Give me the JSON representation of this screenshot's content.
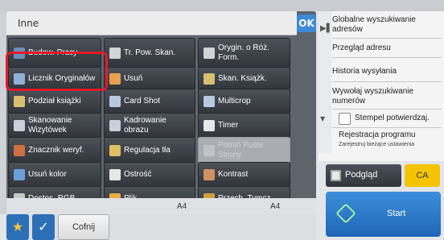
{
  "panel": {
    "title": "Inne",
    "ok_label": "OK"
  },
  "buttons": [
    {
      "id": "budow-pracy",
      "label": "Budow. Pracy",
      "icon_color": "#6b8fb8",
      "icon": "stack-icon"
    },
    {
      "id": "tr-pow-skan",
      "label": "Tr. Pow. Skan.",
      "icon_color": "#d4d4d4",
      "icon": "page-icon"
    },
    {
      "id": "orygin-roz-form",
      "label": "Orygin. o Róż. Form.",
      "icon_color": "#d4d4d4",
      "icon": "pages-icon"
    },
    {
      "id": "licznik-oryginalow",
      "label": "Licznik Oryginałów",
      "icon_color": "#8fb0d8",
      "icon": "counter-icon"
    },
    {
      "id": "usun",
      "label": "Usuń",
      "icon_color": "#e8a050",
      "icon": "erase-icon"
    },
    {
      "id": "skan-ksiazk",
      "label": "Skan. Książk.",
      "icon_color": "#d8c070",
      "icon": "book-icon"
    },
    {
      "id": "podzial-ksiazki",
      "label": "Podział książki",
      "icon_color": "#d8c070",
      "icon": "book-split-icon"
    },
    {
      "id": "card-shot",
      "label": "Card Shot",
      "icon_color": "#b8c8e0",
      "icon": "card-icon"
    },
    {
      "id": "multicrop",
      "label": "Multicrop",
      "icon_color": "#b8c8e0",
      "icon": "crop-icon"
    },
    {
      "id": "skanowanie-wizytowek",
      "label": "Skanowanie Wizytówek",
      "icon_color": "#c8d0dc",
      "icon": "business-card-icon"
    },
    {
      "id": "kadrowanie-obrazu",
      "label": "Kadrowanie obrazu",
      "icon_color": "#c8d0dc",
      "icon": "image-crop-icon"
    },
    {
      "id": "timer",
      "label": "Timer",
      "icon_color": "#e8e8e8",
      "icon": "clock-icon"
    },
    {
      "id": "znacznik-weryf",
      "label": "Znacznik weryf.",
      "icon_color": "#d07040",
      "icon": "verify-stamp-icon"
    },
    {
      "id": "regulacja-tla",
      "label": "Regulacja tła",
      "icon_color": "#e0c060",
      "icon": "background-adjust-icon"
    },
    {
      "id": "pomin-puste-strony",
      "label": "Pomiń Puste Strony",
      "icon_color": "#c0c4c8",
      "icon": "blank-page-icon",
      "disabled": true
    },
    {
      "id": "usun-kolor",
      "label": "Usuń kolor",
      "icon_color": "#6aa0d8",
      "icon": "color-remove-icon"
    },
    {
      "id": "ostrosc",
      "label": "Ostrość",
      "icon_color": "#e8e8e8",
      "icon": "sharpness-icon"
    },
    {
      "id": "kontrast",
      "label": "Kontrast",
      "icon_color": "#d09060",
      "icon": "contrast-icon"
    },
    {
      "id": "dostos-rgb",
      "label": "Dostos. RGB",
      "icon_color": "#c8c8c8",
      "icon": "rgb-sliders-icon"
    },
    {
      "id": "plik",
      "label": "Plik",
      "icon_color": "#e8b040",
      "icon": "folder-icon"
    },
    {
      "id": "przech-tymcz",
      "label": "Przech. Tymcz.",
      "icon_color": "#d0a040",
      "icon": "temp-storage-icon"
    }
  ],
  "paper": {
    "left": "A4",
    "right": "A4"
  },
  "bottom": {
    "star_glyph": "★",
    "check_glyph": "✓",
    "undo_label": "Cofnij"
  },
  "right": {
    "links": [
      "Globalne wyszukiwanie adresów",
      "Przegląd adresu",
      "Historia wysyłania",
      "Wywołaj wyszukiwanie numerów"
    ],
    "checkbox_label": "Stempel potwierdzaj.",
    "reg_label": "Rejestracja programu",
    "reg_sub": "Zarejestruj bieżące ustawienia",
    "preview_label": "Podgląd",
    "ca_label": "CA",
    "start_label": "Start"
  },
  "colors": {
    "highlight": "#e21a2a",
    "accent": "#3c8bd6",
    "ca": "#f4c400"
  }
}
